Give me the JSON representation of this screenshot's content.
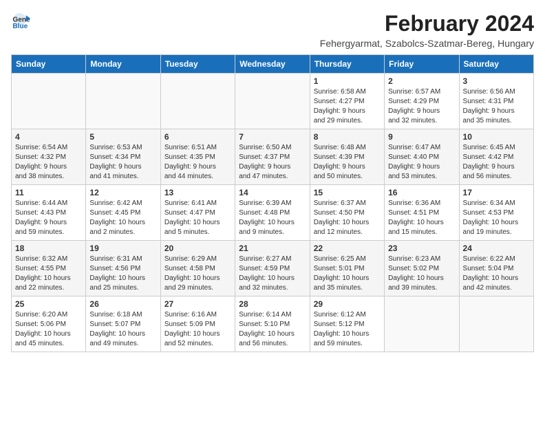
{
  "logo": {
    "text_general": "General",
    "text_blue": "Blue"
  },
  "title": "February 2024",
  "subtitle": "Fehergyarmat, Szabolcs-Szatmar-Bereg, Hungary",
  "weekdays": [
    "Sunday",
    "Monday",
    "Tuesday",
    "Wednesday",
    "Thursday",
    "Friday",
    "Saturday"
  ],
  "weeks": [
    [
      {
        "day": "",
        "detail": ""
      },
      {
        "day": "",
        "detail": ""
      },
      {
        "day": "",
        "detail": ""
      },
      {
        "day": "",
        "detail": ""
      },
      {
        "day": "1",
        "detail": "Sunrise: 6:58 AM\nSunset: 4:27 PM\nDaylight: 9 hours\nand 29 minutes."
      },
      {
        "day": "2",
        "detail": "Sunrise: 6:57 AM\nSunset: 4:29 PM\nDaylight: 9 hours\nand 32 minutes."
      },
      {
        "day": "3",
        "detail": "Sunrise: 6:56 AM\nSunset: 4:31 PM\nDaylight: 9 hours\nand 35 minutes."
      }
    ],
    [
      {
        "day": "4",
        "detail": "Sunrise: 6:54 AM\nSunset: 4:32 PM\nDaylight: 9 hours\nand 38 minutes."
      },
      {
        "day": "5",
        "detail": "Sunrise: 6:53 AM\nSunset: 4:34 PM\nDaylight: 9 hours\nand 41 minutes."
      },
      {
        "day": "6",
        "detail": "Sunrise: 6:51 AM\nSunset: 4:35 PM\nDaylight: 9 hours\nand 44 minutes."
      },
      {
        "day": "7",
        "detail": "Sunrise: 6:50 AM\nSunset: 4:37 PM\nDaylight: 9 hours\nand 47 minutes."
      },
      {
        "day": "8",
        "detail": "Sunrise: 6:48 AM\nSunset: 4:39 PM\nDaylight: 9 hours\nand 50 minutes."
      },
      {
        "day": "9",
        "detail": "Sunrise: 6:47 AM\nSunset: 4:40 PM\nDaylight: 9 hours\nand 53 minutes."
      },
      {
        "day": "10",
        "detail": "Sunrise: 6:45 AM\nSunset: 4:42 PM\nDaylight: 9 hours\nand 56 minutes."
      }
    ],
    [
      {
        "day": "11",
        "detail": "Sunrise: 6:44 AM\nSunset: 4:43 PM\nDaylight: 9 hours\nand 59 minutes."
      },
      {
        "day": "12",
        "detail": "Sunrise: 6:42 AM\nSunset: 4:45 PM\nDaylight: 10 hours\nand 2 minutes."
      },
      {
        "day": "13",
        "detail": "Sunrise: 6:41 AM\nSunset: 4:47 PM\nDaylight: 10 hours\nand 5 minutes."
      },
      {
        "day": "14",
        "detail": "Sunrise: 6:39 AM\nSunset: 4:48 PM\nDaylight: 10 hours\nand 9 minutes."
      },
      {
        "day": "15",
        "detail": "Sunrise: 6:37 AM\nSunset: 4:50 PM\nDaylight: 10 hours\nand 12 minutes."
      },
      {
        "day": "16",
        "detail": "Sunrise: 6:36 AM\nSunset: 4:51 PM\nDaylight: 10 hours\nand 15 minutes."
      },
      {
        "day": "17",
        "detail": "Sunrise: 6:34 AM\nSunset: 4:53 PM\nDaylight: 10 hours\nand 19 minutes."
      }
    ],
    [
      {
        "day": "18",
        "detail": "Sunrise: 6:32 AM\nSunset: 4:55 PM\nDaylight: 10 hours\nand 22 minutes."
      },
      {
        "day": "19",
        "detail": "Sunrise: 6:31 AM\nSunset: 4:56 PM\nDaylight: 10 hours\nand 25 minutes."
      },
      {
        "day": "20",
        "detail": "Sunrise: 6:29 AM\nSunset: 4:58 PM\nDaylight: 10 hours\nand 29 minutes."
      },
      {
        "day": "21",
        "detail": "Sunrise: 6:27 AM\nSunset: 4:59 PM\nDaylight: 10 hours\nand 32 minutes."
      },
      {
        "day": "22",
        "detail": "Sunrise: 6:25 AM\nSunset: 5:01 PM\nDaylight: 10 hours\nand 35 minutes."
      },
      {
        "day": "23",
        "detail": "Sunrise: 6:23 AM\nSunset: 5:02 PM\nDaylight: 10 hours\nand 39 minutes."
      },
      {
        "day": "24",
        "detail": "Sunrise: 6:22 AM\nSunset: 5:04 PM\nDaylight: 10 hours\nand 42 minutes."
      }
    ],
    [
      {
        "day": "25",
        "detail": "Sunrise: 6:20 AM\nSunset: 5:06 PM\nDaylight: 10 hours\nand 45 minutes."
      },
      {
        "day": "26",
        "detail": "Sunrise: 6:18 AM\nSunset: 5:07 PM\nDaylight: 10 hours\nand 49 minutes."
      },
      {
        "day": "27",
        "detail": "Sunrise: 6:16 AM\nSunset: 5:09 PM\nDaylight: 10 hours\nand 52 minutes."
      },
      {
        "day": "28",
        "detail": "Sunrise: 6:14 AM\nSunset: 5:10 PM\nDaylight: 10 hours\nand 56 minutes."
      },
      {
        "day": "29",
        "detail": "Sunrise: 6:12 AM\nSunset: 5:12 PM\nDaylight: 10 hours\nand 59 minutes."
      },
      {
        "day": "",
        "detail": ""
      },
      {
        "day": "",
        "detail": ""
      }
    ]
  ]
}
